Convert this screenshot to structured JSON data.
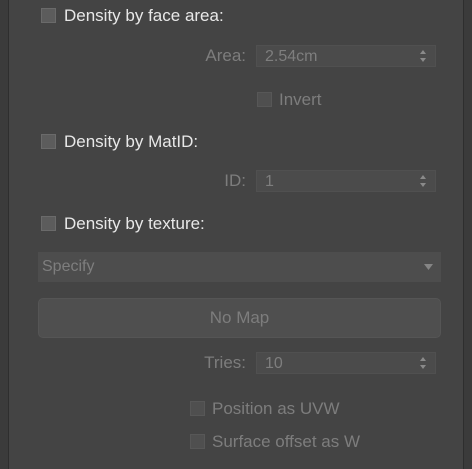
{
  "density_face_area": {
    "checkbox_label": "Density by face area:",
    "area_label": "Area:",
    "area_value": "2.54cm",
    "invert_label": "Invert"
  },
  "density_matid": {
    "checkbox_label": "Density by MatID:",
    "id_label": "ID:",
    "id_value": "1"
  },
  "density_texture": {
    "checkbox_label": "Density by texture:",
    "mode_selected": "Specify",
    "map_button_label": "No Map",
    "tries_label": "Tries:",
    "tries_value": "10",
    "position_uvw_label": "Position as UVW",
    "surface_offset_label": "Surface offset as W"
  },
  "icons": {
    "spinner": "spinner-arrows-icon",
    "dropdown": "chevron-down-icon"
  },
  "colors": {
    "panel_background": "#444444",
    "enabled_text": "#e8e8e8",
    "disabled_text": "#7d7d7d"
  }
}
